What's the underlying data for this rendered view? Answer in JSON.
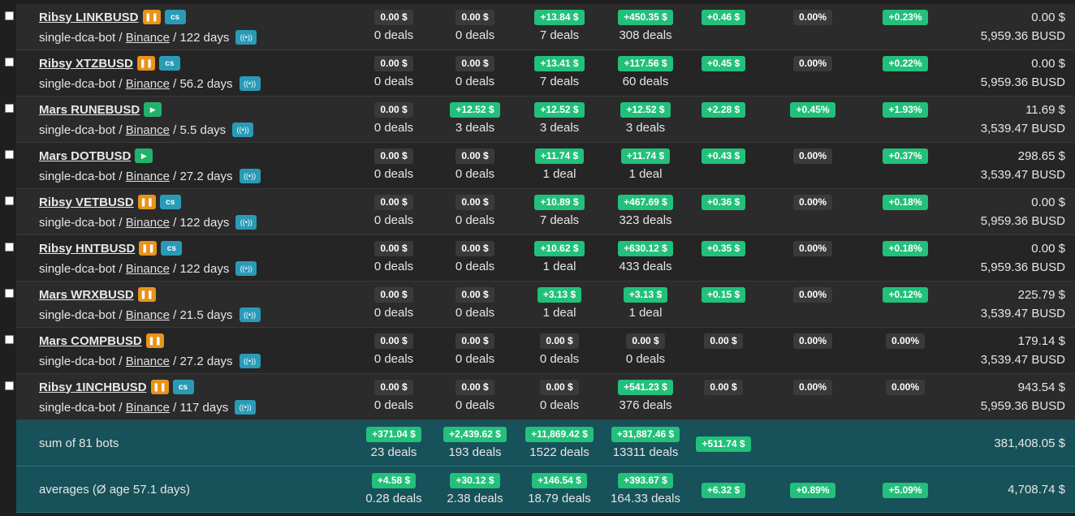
{
  "rows": [
    {
      "name": "Ribsy LINKBUSD",
      "state": "pause",
      "cs": true,
      "type": "single-dca-bot",
      "exchange": "Binance",
      "age": "122 days",
      "c1": {
        "v": "0.00 $",
        "d": "0 deals",
        "pos": false
      },
      "c2": {
        "v": "0.00 $",
        "d": "0 deals",
        "pos": false
      },
      "c3": {
        "v": "+13.84 $",
        "d": "7 deals",
        "pos": true
      },
      "c4": {
        "v": "+450.35 $",
        "d": "308 deals",
        "pos": true
      },
      "p1": {
        "v": "+0.46 $",
        "pos": true
      },
      "p2": {
        "v": "0.00%",
        "pos": false
      },
      "p3": {
        "v": "+0.23%",
        "pos": true
      },
      "r1": "0.00 $",
      "r2": "5,959.36 BUSD"
    },
    {
      "name": "Ribsy XTZBUSD",
      "state": "pause",
      "cs": true,
      "type": "single-dca-bot",
      "exchange": "Binance",
      "age": "56.2 days",
      "c1": {
        "v": "0.00 $",
        "d": "0 deals",
        "pos": false
      },
      "c2": {
        "v": "0.00 $",
        "d": "0 deals",
        "pos": false
      },
      "c3": {
        "v": "+13.41 $",
        "d": "7 deals",
        "pos": true
      },
      "c4": {
        "v": "+117.56 $",
        "d": "60 deals",
        "pos": true
      },
      "p1": {
        "v": "+0.45 $",
        "pos": true
      },
      "p2": {
        "v": "0.00%",
        "pos": false
      },
      "p3": {
        "v": "+0.22%",
        "pos": true
      },
      "r1": "0.00 $",
      "r2": "5,959.36 BUSD"
    },
    {
      "name": "Mars RUNEBUSD",
      "state": "play",
      "cs": false,
      "type": "single-dca-bot",
      "exchange": "Binance",
      "age": "5.5 days",
      "c1": {
        "v": "0.00 $",
        "d": "0 deals",
        "pos": false
      },
      "c2": {
        "v": "+12.52 $",
        "d": "3 deals",
        "pos": true
      },
      "c3": {
        "v": "+12.52 $",
        "d": "3 deals",
        "pos": true
      },
      "c4": {
        "v": "+12.52 $",
        "d": "3 deals",
        "pos": true
      },
      "p1": {
        "v": "+2.28 $",
        "pos": true
      },
      "p2": {
        "v": "+0.45%",
        "pos": true
      },
      "p3": {
        "v": "+1.93%",
        "pos": true
      },
      "r1": "11.69 $",
      "r2": "3,539.47 BUSD"
    },
    {
      "name": "Mars DOTBUSD",
      "state": "play",
      "cs": false,
      "type": "single-dca-bot",
      "exchange": "Binance",
      "age": "27.2 days",
      "c1": {
        "v": "0.00 $",
        "d": "0 deals",
        "pos": false
      },
      "c2": {
        "v": "0.00 $",
        "d": "0 deals",
        "pos": false
      },
      "c3": {
        "v": "+11.74 $",
        "d": "1 deal",
        "pos": true
      },
      "c4": {
        "v": "+11.74 $",
        "d": "1 deal",
        "pos": true
      },
      "p1": {
        "v": "+0.43 $",
        "pos": true
      },
      "p2": {
        "v": "0.00%",
        "pos": false
      },
      "p3": {
        "v": "+0.37%",
        "pos": true
      },
      "r1": "298.65 $",
      "r2": "3,539.47 BUSD"
    },
    {
      "name": "Ribsy VETBUSD",
      "state": "pause",
      "cs": true,
      "type": "single-dca-bot",
      "exchange": "Binance",
      "age": "122 days",
      "c1": {
        "v": "0.00 $",
        "d": "0 deals",
        "pos": false
      },
      "c2": {
        "v": "0.00 $",
        "d": "0 deals",
        "pos": false
      },
      "c3": {
        "v": "+10.89 $",
        "d": "7 deals",
        "pos": true
      },
      "c4": {
        "v": "+467.69 $",
        "d": "323 deals",
        "pos": true
      },
      "p1": {
        "v": "+0.36 $",
        "pos": true
      },
      "p2": {
        "v": "0.00%",
        "pos": false
      },
      "p3": {
        "v": "+0.18%",
        "pos": true
      },
      "r1": "0.00 $",
      "r2": "5,959.36 BUSD"
    },
    {
      "name": "Ribsy HNTBUSD",
      "state": "pause",
      "cs": true,
      "type": "single-dca-bot",
      "exchange": "Binance",
      "age": "122 days",
      "c1": {
        "v": "0.00 $",
        "d": "0 deals",
        "pos": false
      },
      "c2": {
        "v": "0.00 $",
        "d": "0 deals",
        "pos": false
      },
      "c3": {
        "v": "+10.62 $",
        "d": "1 deal",
        "pos": true
      },
      "c4": {
        "v": "+630.12 $",
        "d": "433 deals",
        "pos": true
      },
      "p1": {
        "v": "+0.35 $",
        "pos": true
      },
      "p2": {
        "v": "0.00%",
        "pos": false
      },
      "p3": {
        "v": "+0.18%",
        "pos": true
      },
      "r1": "0.00 $",
      "r2": "5,959.36 BUSD"
    },
    {
      "name": "Mars WRXBUSD",
      "state": "pause",
      "cs": false,
      "type": "single-dca-bot",
      "exchange": "Binance",
      "age": "21.5 days",
      "c1": {
        "v": "0.00 $",
        "d": "0 deals",
        "pos": false
      },
      "c2": {
        "v": "0.00 $",
        "d": "0 deals",
        "pos": false
      },
      "c3": {
        "v": "+3.13 $",
        "d": "1 deal",
        "pos": true
      },
      "c4": {
        "v": "+3.13 $",
        "d": "1 deal",
        "pos": true
      },
      "p1": {
        "v": "+0.15 $",
        "pos": true
      },
      "p2": {
        "v": "0.00%",
        "pos": false
      },
      "p3": {
        "v": "+0.12%",
        "pos": true
      },
      "r1": "225.79 $",
      "r2": "3,539.47 BUSD"
    },
    {
      "name": "Mars COMPBUSD",
      "state": "pause",
      "cs": false,
      "type": "single-dca-bot",
      "exchange": "Binance",
      "age": "27.2 days",
      "c1": {
        "v": "0.00 $",
        "d": "0 deals",
        "pos": false
      },
      "c2": {
        "v": "0.00 $",
        "d": "0 deals",
        "pos": false
      },
      "c3": {
        "v": "0.00 $",
        "d": "0 deals",
        "pos": false
      },
      "c4": {
        "v": "0.00 $",
        "d": "0 deals",
        "pos": false
      },
      "p1": {
        "v": "0.00 $",
        "pos": false
      },
      "p2": {
        "v": "0.00%",
        "pos": false
      },
      "p3": {
        "v": "0.00%",
        "pos": false
      },
      "r1": "179.14 $",
      "r2": "3,539.47 BUSD"
    },
    {
      "name": "Ribsy 1INCHBUSD",
      "state": "pause",
      "cs": true,
      "type": "single-dca-bot",
      "exchange": "Binance",
      "age": "117 days",
      "c1": {
        "v": "0.00 $",
        "d": "0 deals",
        "pos": false
      },
      "c2": {
        "v": "0.00 $",
        "d": "0 deals",
        "pos": false
      },
      "c3": {
        "v": "0.00 $",
        "d": "0 deals",
        "pos": false
      },
      "c4": {
        "v": "+541.23 $",
        "d": "376 deals",
        "pos": true
      },
      "p1": {
        "v": "0.00 $",
        "pos": false
      },
      "p2": {
        "v": "0.00%",
        "pos": false
      },
      "p3": {
        "v": "0.00%",
        "pos": false
      },
      "r1": "943.54 $",
      "r2": "5,959.36 BUSD"
    }
  ],
  "summary": {
    "label": "sum of 81 bots",
    "c1": {
      "v": "+371.04 $",
      "d": "23 deals"
    },
    "c2": {
      "v": "+2,439.62 $",
      "d": "193 deals"
    },
    "c3": {
      "v": "+11,869.42 $",
      "d": "1522 deals"
    },
    "c4": {
      "v": "+31,887.46 $",
      "d": "13311 deals"
    },
    "p1": "+511.74 $",
    "total": "381,408.05 $"
  },
  "averages": {
    "label": "averages (Ø age 57.1 days)",
    "c1": {
      "v": "+4.58 $",
      "d": "0.28 deals"
    },
    "c2": {
      "v": "+30.12 $",
      "d": "2.38 deals"
    },
    "c3": {
      "v": "+146.54 $",
      "d": "18.79 deals"
    },
    "c4": {
      "v": "+393.67 $",
      "d": "164.33 deals"
    },
    "p1": "+6.32 $",
    "p2": "+0.89%",
    "p3": "+5.09%",
    "total": "4,708.74 $"
  },
  "labels": {
    "cs": "cs",
    "pause": "❚❚",
    "play": "▶",
    "signal": "((•))",
    "sep": " / "
  },
  "colors": {
    "positive": "#22c07a",
    "zero": "#3a3a3a",
    "pause": "#e8931b",
    "play": "#21b36b",
    "info": "#2a9bb7",
    "summary_bg": "#175159"
  }
}
